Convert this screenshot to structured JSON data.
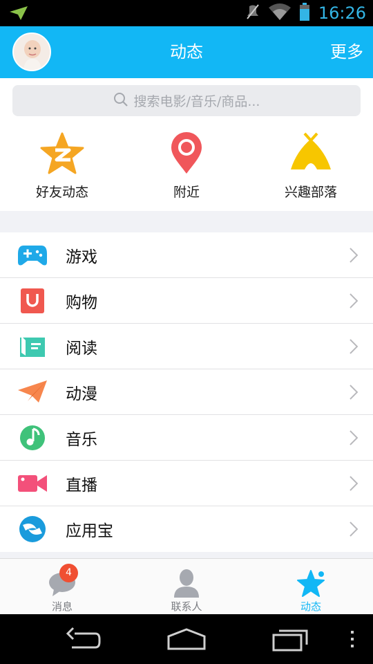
{
  "status_bar": {
    "time": "16:26",
    "icons": [
      "send-icon",
      "mute-icon",
      "wifi-icon",
      "battery-icon"
    ],
    "color": "#33b5e5"
  },
  "header": {
    "title": "动态",
    "more_label": "更多",
    "background": "#12b7f5"
  },
  "search": {
    "placeholder": "搜索电影/音乐/商品..."
  },
  "quick_actions": [
    {
      "label": "好友动态",
      "icon": "qzone-star-icon"
    },
    {
      "label": "附近",
      "icon": "location-pin-icon"
    },
    {
      "label": "兴趣部落",
      "icon": "tribe-tent-icon"
    }
  ],
  "menu": [
    {
      "label": "游戏",
      "icon": "gamepad-icon"
    },
    {
      "label": "购物",
      "icon": "shopping-bag-icon"
    },
    {
      "label": "阅读",
      "icon": "book-icon"
    },
    {
      "label": "动漫",
      "icon": "paper-plane-icon"
    },
    {
      "label": "音乐",
      "icon": "music-note-icon"
    },
    {
      "label": "直播",
      "icon": "video-camera-icon"
    },
    {
      "label": "应用宝",
      "icon": "app-store-icon"
    }
  ],
  "tabbar": {
    "messages": {
      "label": "消息",
      "badge": "4"
    },
    "contacts": {
      "label": "联系人"
    },
    "feed": {
      "label": "动态",
      "active": true
    },
    "accent": "#12b7f5"
  }
}
